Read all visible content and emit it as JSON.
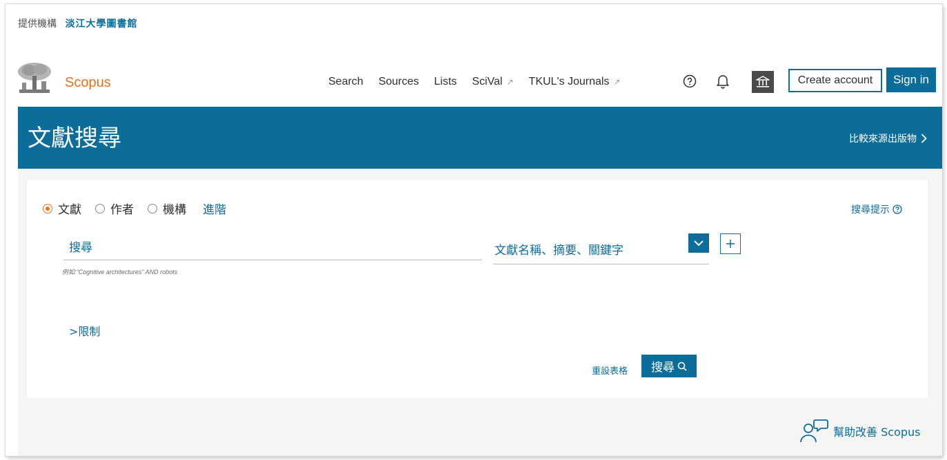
{
  "institution": {
    "label": "提供機構",
    "name": "淡江大學圖書館"
  },
  "brand": "Scopus",
  "nav": {
    "items": [
      {
        "label": "Search",
        "external": false
      },
      {
        "label": "Sources",
        "external": false
      },
      {
        "label": "Lists",
        "external": false
      },
      {
        "label": "SciVal",
        "external": true,
        "ext_icon": "↗"
      },
      {
        "label": "TKUL's Journals",
        "external": true,
        "ext_icon": "↗"
      }
    ]
  },
  "header_buttons": {
    "create_account": "Create account",
    "sign_in": "Sign in"
  },
  "banner": {
    "title": "文獻搜尋",
    "compare_link": "比較來源出版物"
  },
  "search_form": {
    "types": [
      {
        "label": "文獻",
        "selected": true
      },
      {
        "label": "作者",
        "selected": false
      },
      {
        "label": "機構",
        "selected": false
      }
    ],
    "advanced": "進階",
    "tips": "搜尋提示",
    "search_placeholder": "搜尋",
    "example": "例如:\"Cognitive architectures\" AND robots",
    "field_value": "文獻名稱、摘要、關鍵字",
    "limits": "限制",
    "limits_icon": ">",
    "reset": "重設表格",
    "submit": "搜尋"
  },
  "feedback": "幫助改善 Scopus",
  "colors": {
    "primary": "#0c6c9a",
    "accent": "#e9711c",
    "dark": "#4a4a4a"
  }
}
